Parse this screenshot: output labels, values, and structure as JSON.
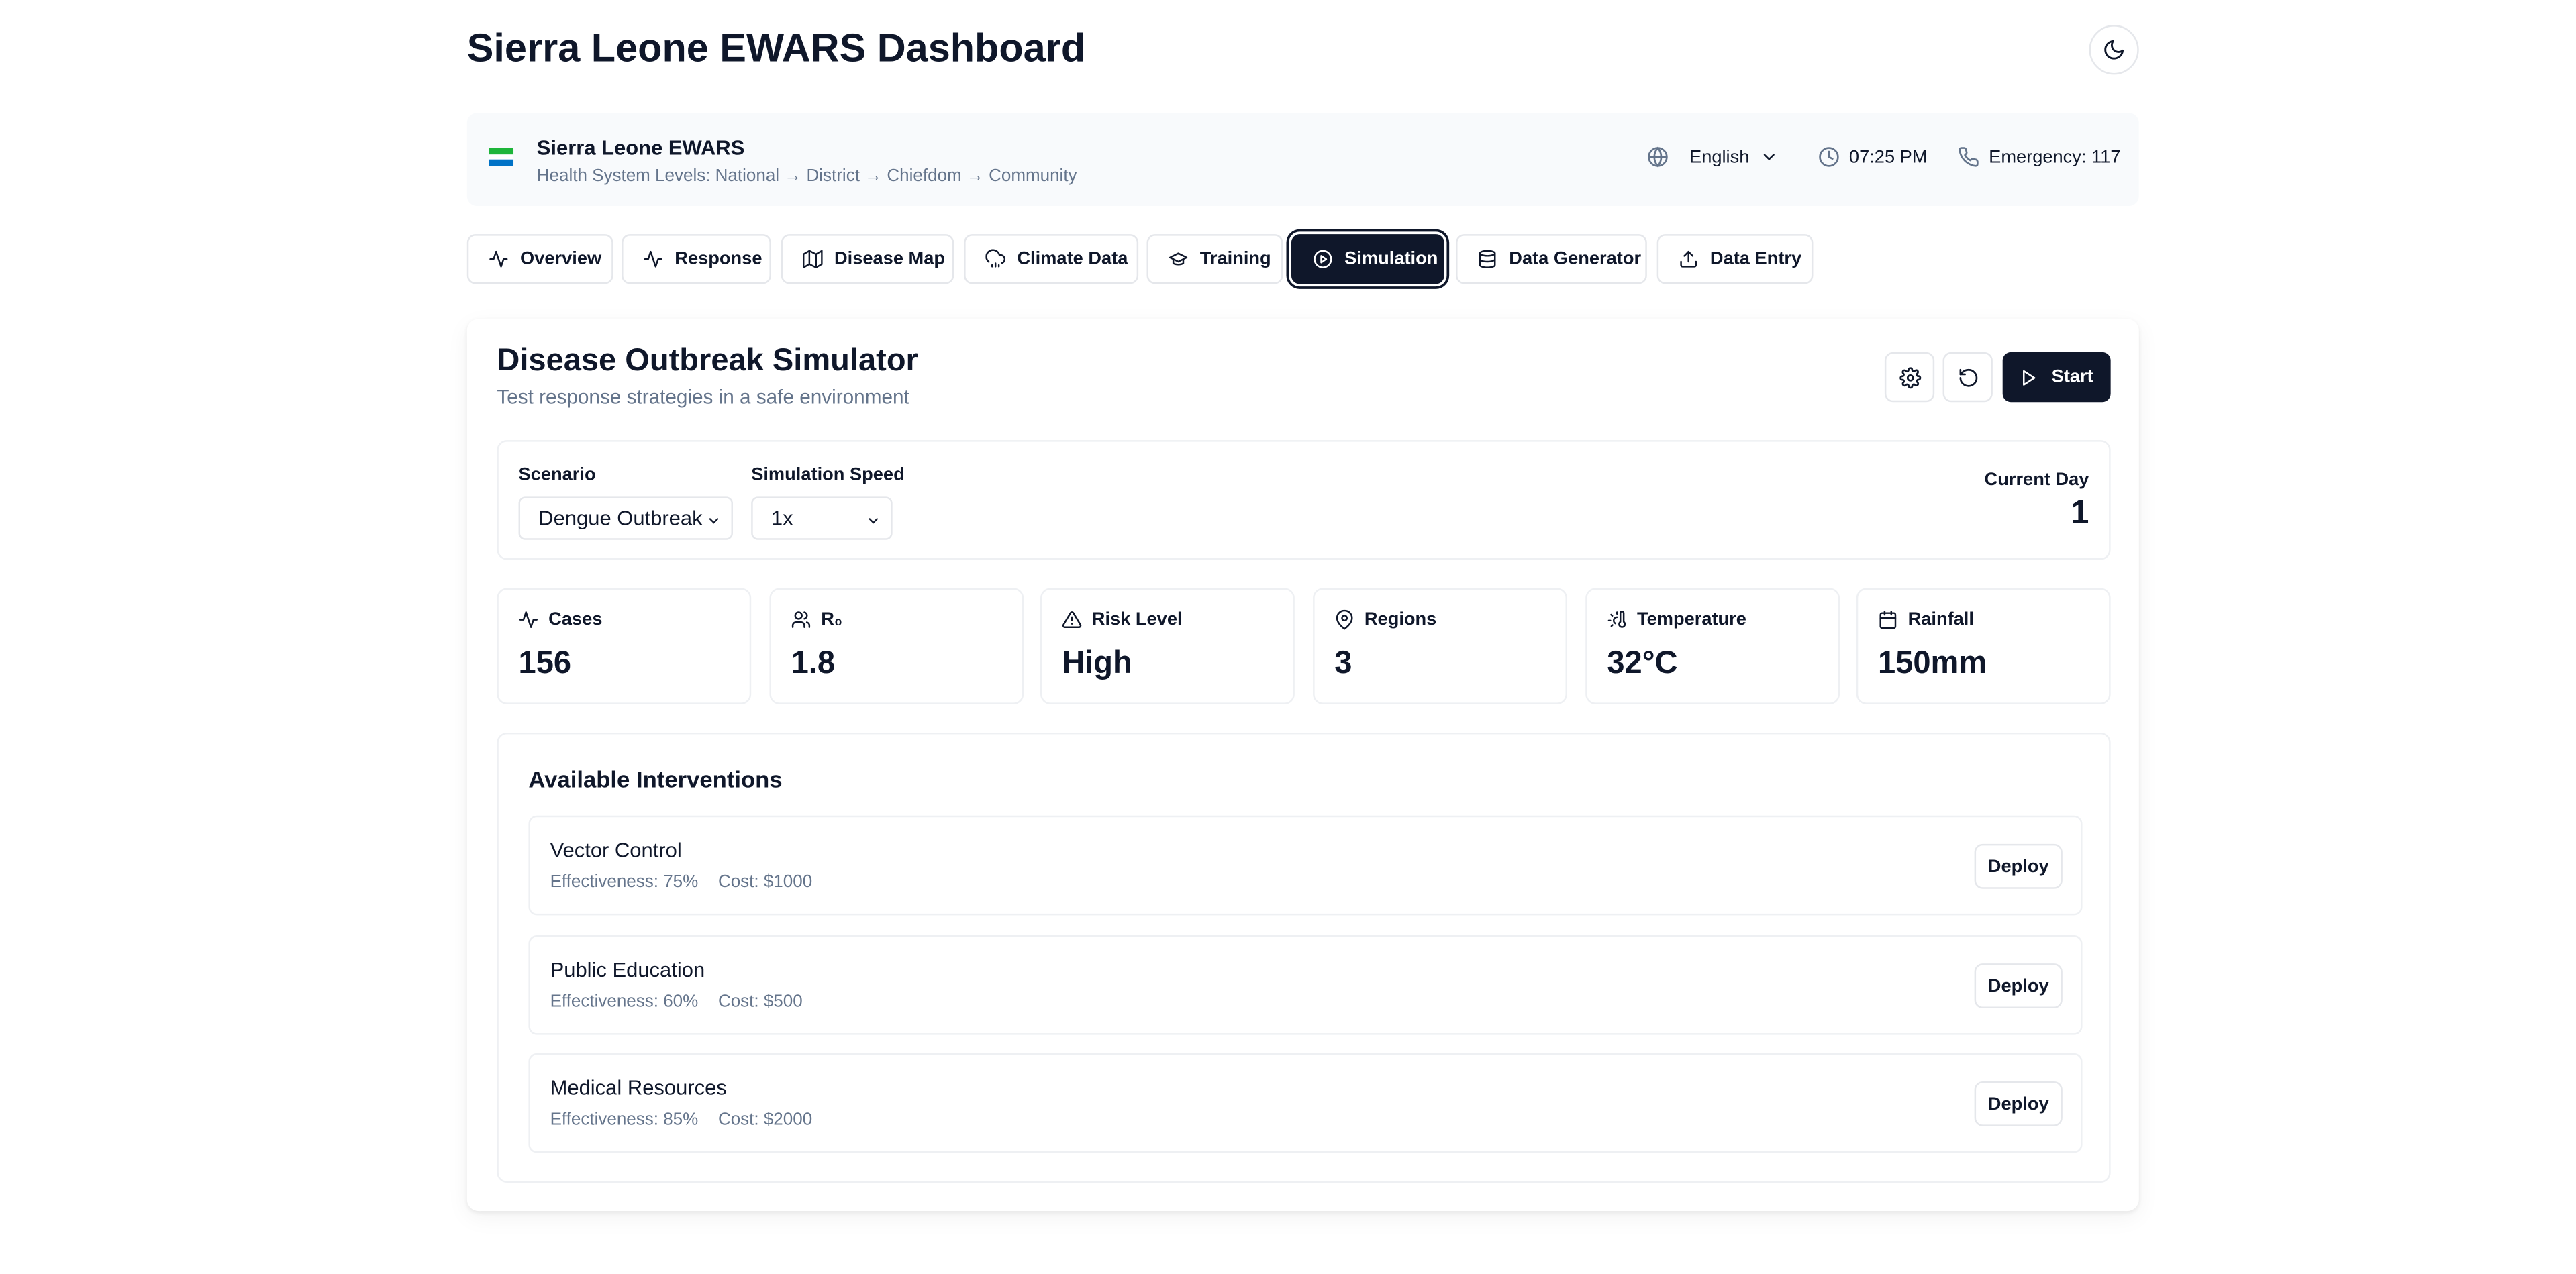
{
  "header": {
    "title": "Sierra Leone EWARS Dashboard",
    "theme_icon": "moon-icon"
  },
  "infobar": {
    "org_name": "Sierra Leone EWARS",
    "levels": "Health System Levels: National → District → Chiefdom → Community",
    "language": "English",
    "time": "07:25 PM",
    "emergency": "Emergency: 117",
    "flag_colors": [
      "#1eb53a",
      "#ffffff",
      "#0072c6"
    ]
  },
  "tabs": [
    {
      "label": "Overview",
      "icon": "activity-icon"
    },
    {
      "label": "Response",
      "icon": "activity-icon"
    },
    {
      "label": "Disease Map",
      "icon": "map-icon"
    },
    {
      "label": "Climate Data",
      "icon": "cloud-rain-icon"
    },
    {
      "label": "Training",
      "icon": "graduation-cap-icon"
    },
    {
      "label": "Simulation",
      "icon": "play-circle-icon",
      "active": true
    },
    {
      "label": "Data Generator",
      "icon": "database-icon"
    },
    {
      "label": "Data Entry",
      "icon": "upload-icon"
    }
  ],
  "simulator": {
    "title": "Disease Outbreak Simulator",
    "subtitle": "Test response strategies in a safe environment",
    "start_label": "Start"
  },
  "controls": {
    "scenario_label": "Scenario",
    "scenario_value": "Dengue Outbreak",
    "speed_label": "Simulation Speed",
    "speed_value": "1x",
    "day_label": "Current Day",
    "day_value": "1"
  },
  "stats": [
    {
      "label": "Cases",
      "value": "156",
      "icon": "activity-icon"
    },
    {
      "label": "R₀",
      "value": "1.8",
      "icon": "users-icon"
    },
    {
      "label": "Risk Level",
      "value": "High",
      "icon": "alert-triangle-icon"
    },
    {
      "label": "Regions",
      "value": "3",
      "icon": "map-pin-icon"
    },
    {
      "label": "Temperature",
      "value": "32°C",
      "icon": "thermometer-sun-icon"
    },
    {
      "label": "Rainfall",
      "value": "150mm",
      "icon": "calendar-icon"
    }
  ],
  "interventions": {
    "title": "Available Interventions",
    "deploy_label": "Deploy",
    "items": [
      {
        "name": "Vector Control",
        "effectiveness": "Effectiveness: 75%",
        "cost": "Cost: $1000"
      },
      {
        "name": "Public Education",
        "effectiveness": "Effectiveness: 60%",
        "cost": "Cost: $500"
      },
      {
        "name": "Medical Resources",
        "effectiveness": "Effectiveness: 85%",
        "cost": "Cost: $2000"
      }
    ]
  },
  "colors": {
    "primary": "#0f172a",
    "muted": "#64748b",
    "border": "#e5e7eb",
    "panel": "#f8fafc"
  }
}
